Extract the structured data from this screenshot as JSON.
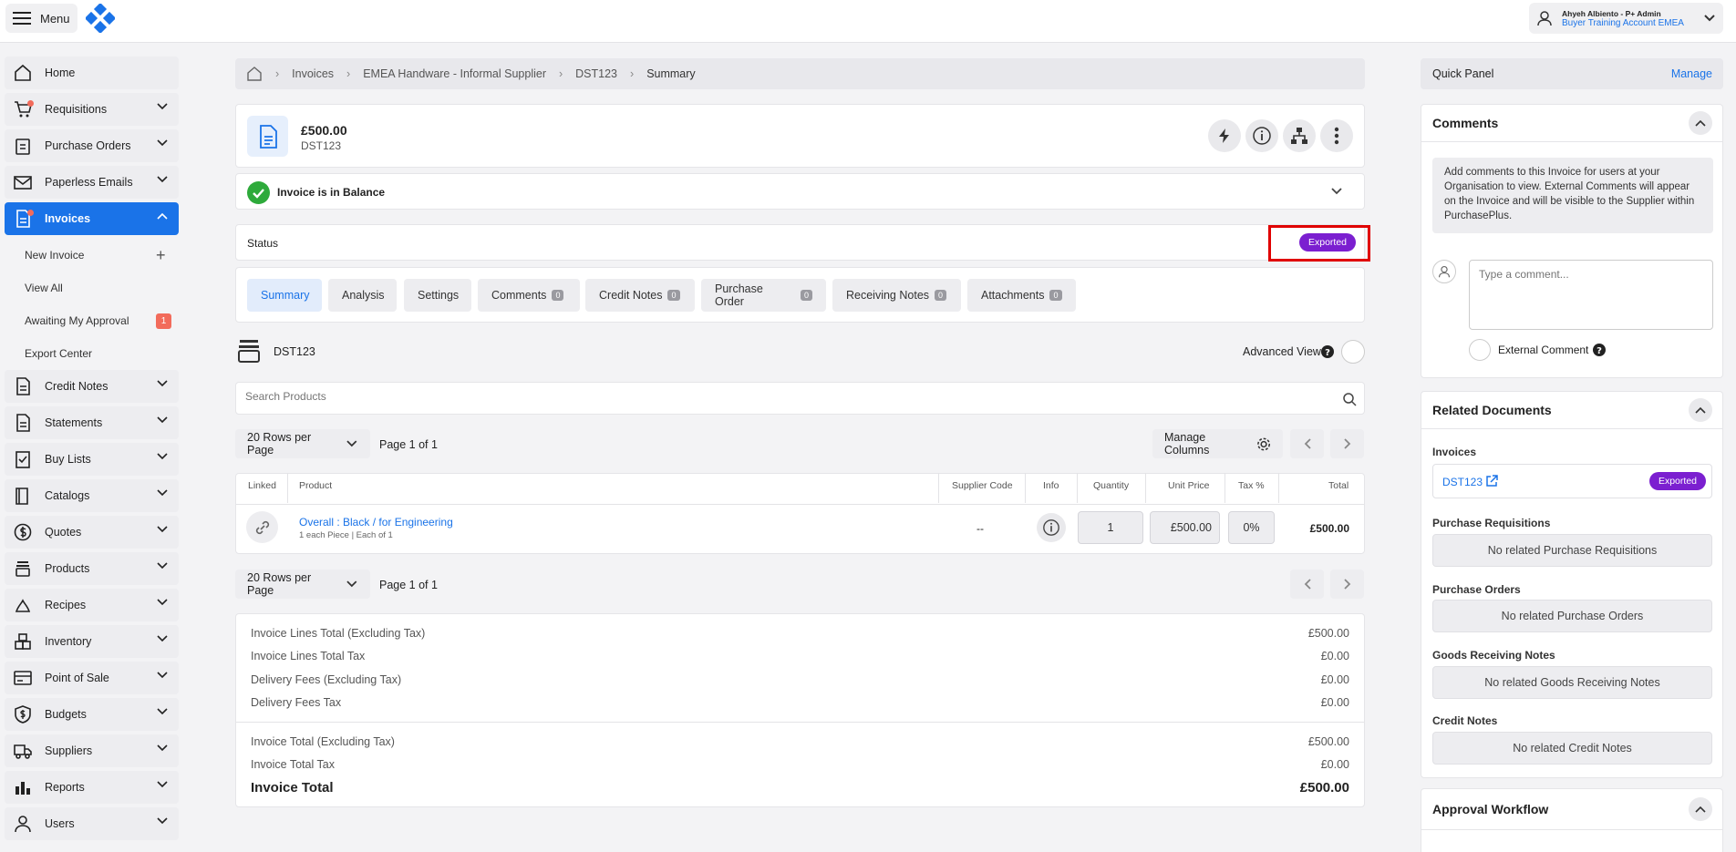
{
  "topbar": {
    "menu_label": "Menu",
    "user_name": "Ahyeh Albiento - P+ Admin",
    "user_account": "Buyer Training Account EMEA"
  },
  "sidebar": {
    "items": [
      {
        "label": "Home",
        "icon": "home-icon"
      },
      {
        "label": "Requisitions",
        "icon": "cart-icon"
      },
      {
        "label": "Purchase Orders",
        "icon": "clipboard-icon"
      },
      {
        "label": "Paperless Emails",
        "icon": "mail-icon"
      },
      {
        "label": "Invoices",
        "icon": "invoice-icon"
      },
      {
        "label": "Credit Notes",
        "icon": "document-icon"
      },
      {
        "label": "Statements",
        "icon": "document-icon"
      },
      {
        "label": "Buy Lists",
        "icon": "checklist-icon"
      },
      {
        "label": "Catalogs",
        "icon": "book-icon"
      },
      {
        "label": "Quotes",
        "icon": "dollar-icon"
      },
      {
        "label": "Products",
        "icon": "stack-icon"
      },
      {
        "label": "Recipes",
        "icon": "chef-icon"
      },
      {
        "label": "Inventory",
        "icon": "boxes-icon"
      },
      {
        "label": "Point of Sale",
        "icon": "card-icon"
      },
      {
        "label": "Budgets",
        "icon": "shield-dollar-icon"
      },
      {
        "label": "Suppliers",
        "icon": "truck-icon"
      },
      {
        "label": "Reports",
        "icon": "bar-chart-icon"
      },
      {
        "label": "Users",
        "icon": "user-icon"
      }
    ],
    "invoice_sub": [
      {
        "label": "New Invoice"
      },
      {
        "label": "View All"
      },
      {
        "label": "Awaiting My Approval",
        "badge": "1"
      },
      {
        "label": "Export Center"
      }
    ]
  },
  "breadcrumb": [
    "Invoices",
    "EMEA Handware - Informal Supplier",
    "DST123",
    "Summary"
  ],
  "header": {
    "amount": "£500.00",
    "number": "DST123"
  },
  "balance": {
    "label": "Invoice is in Balance"
  },
  "status": {
    "label": "Status",
    "value": "Exported"
  },
  "tabs": [
    {
      "label": "Summary"
    },
    {
      "label": "Analysis"
    },
    {
      "label": "Settings"
    },
    {
      "label": "Comments",
      "count": "0"
    },
    {
      "label": "Credit Notes",
      "count": "0"
    },
    {
      "label": "Purchase Order",
      "count": "0"
    },
    {
      "label": "Receiving Notes",
      "count": "0"
    },
    {
      "label": "Attachments",
      "count": "0"
    }
  ],
  "lines": {
    "title": "DST123",
    "advanced_view": "Advanced View",
    "search_placeholder": "Search Products",
    "rows_per_page": "20 Rows per Page",
    "page_info": "Page 1 of 1",
    "manage_columns": "Manage Columns",
    "columns": [
      "Linked",
      "Product",
      "Supplier Code",
      "Info",
      "Quantity",
      "Unit Price",
      "Tax %",
      "Total"
    ],
    "rows": [
      {
        "product": "Overall : Black / for Engineering",
        "product_sub": "1 each Piece | Each of 1",
        "supplier_code": "--",
        "quantity": "1",
        "unit_price": "£500.00",
        "tax": "0%",
        "total": "£500.00"
      }
    ]
  },
  "totals": {
    "lines_total_label": "Invoice Lines Total (Excluding Tax)",
    "lines_total": "£500.00",
    "lines_tax_label": "Invoice Lines Total Tax",
    "lines_tax": "£0.00",
    "delivery_label": "Delivery Fees (Excluding Tax)",
    "delivery": "£0.00",
    "delivery_tax_label": "Delivery Fees Tax",
    "delivery_tax": "£0.00",
    "invoice_total_ex_label": "Invoice Total (Excluding Tax)",
    "invoice_total_ex": "£500.00",
    "invoice_tax_label": "Invoice Total Tax",
    "invoice_tax": "£0.00",
    "invoice_total_label": "Invoice Total",
    "invoice_total": "£500.00"
  },
  "quick_panel": {
    "title": "Quick Panel",
    "manage": "Manage"
  },
  "comments_panel": {
    "title": "Comments",
    "info": "Add comments to this Invoice for users at your Organisation to view. External Comments will appear on the Invoice and will be visible to the Supplier within PurchasePlus.",
    "placeholder": "Type a comment...",
    "external": "External Comment"
  },
  "related": {
    "title": "Related Documents",
    "invoices_label": "Invoices",
    "invoice_link": "DST123",
    "invoice_status": "Exported",
    "pr_label": "Purchase Requisitions",
    "pr_empty": "No related Purchase Requisitions",
    "po_label": "Purchase Orders",
    "po_empty": "No related Purchase Orders",
    "grn_label": "Goods Receiving Notes",
    "grn_empty": "No related Goods Receiving Notes",
    "cn_label": "Credit Notes",
    "cn_empty": "No related Credit Notes"
  },
  "approval": {
    "title": "Approval Workflow"
  },
  "colors": {
    "accent": "#1a73e8",
    "exported": "#7b1fd0",
    "success": "#2eaa3b",
    "alert": "#f26b5b",
    "highlight": "#e00000"
  }
}
